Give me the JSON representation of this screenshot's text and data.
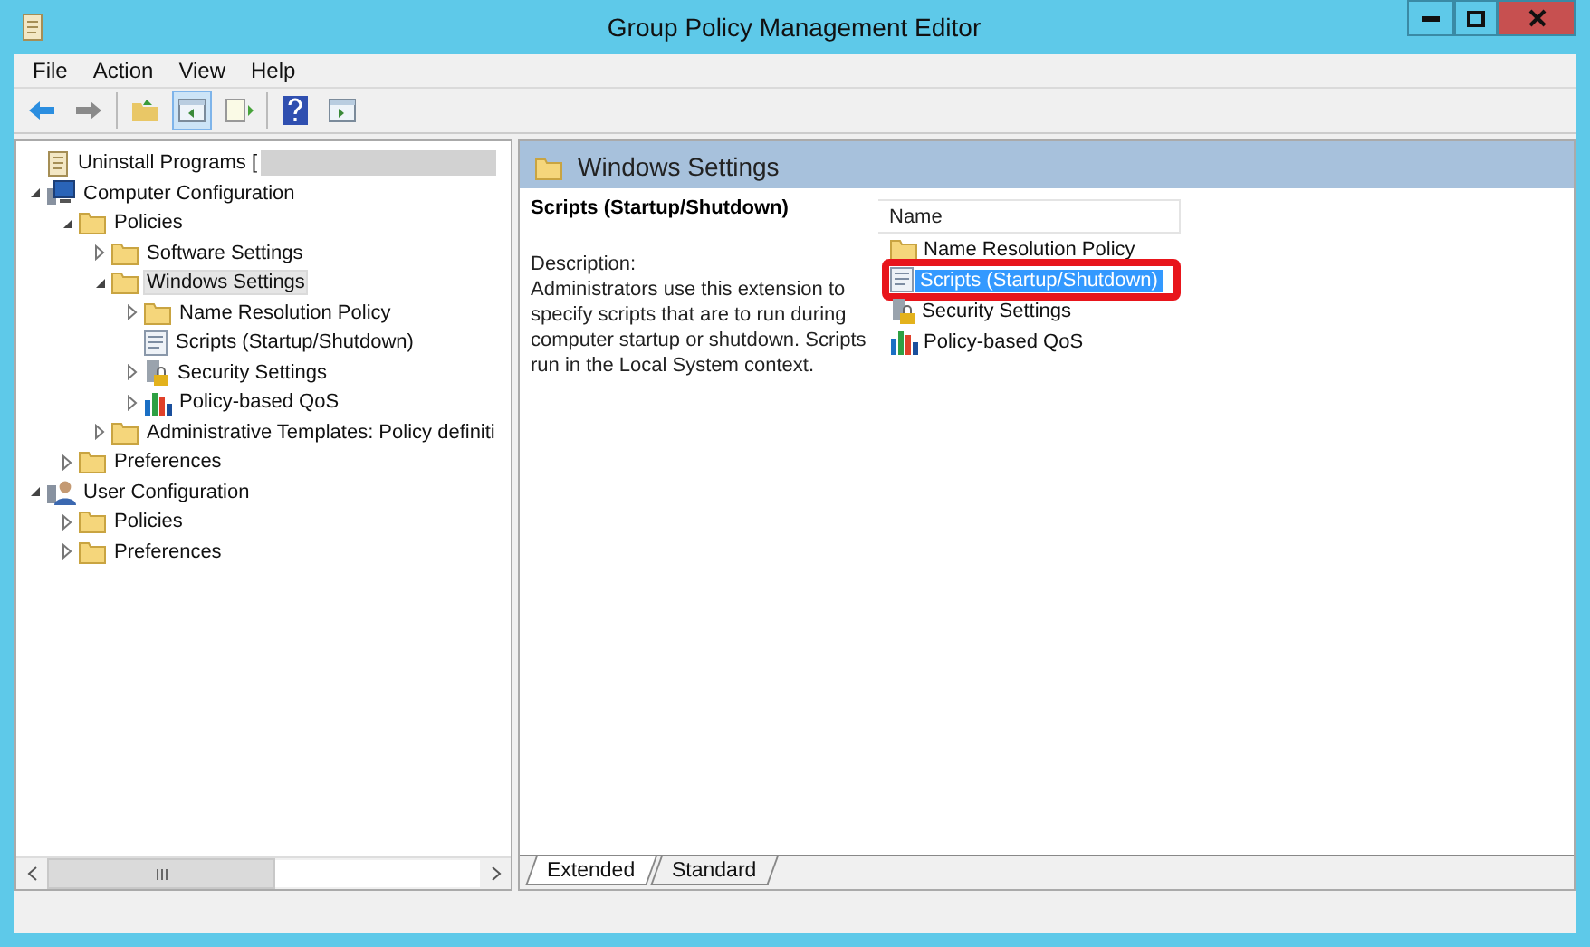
{
  "window": {
    "title": "Group Policy Management Editor"
  },
  "menu": [
    "File",
    "Action",
    "View",
    "Help"
  ],
  "tree": [
    {
      "label": "Uninstall Programs [",
      "kind": "document",
      "selected": false,
      "redacted": true
    },
    {
      "label": "Computer Configuration",
      "kind": "computer",
      "expanded": true,
      "selected": false,
      "children": [
        {
          "label": "Policies",
          "kind": "folder",
          "expanded": true,
          "selected": false,
          "children": [
            {
              "label": "Software Settings",
              "kind": "folder",
              "expanded": false,
              "selected": false
            },
            {
              "label": "Windows Settings",
              "kind": "folder",
              "expanded": true,
              "selected": true,
              "children": [
                {
                  "label": "Name Resolution Policy",
                  "kind": "folder",
                  "expanded": false,
                  "selected": false
                },
                {
                  "label": "Scripts (Startup/Shutdown)",
                  "kind": "script",
                  "selected": false
                },
                {
                  "label": "Security Settings",
                  "kind": "security",
                  "expanded": false,
                  "selected": false
                },
                {
                  "label": "Policy-based QoS",
                  "kind": "chart",
                  "expanded": false,
                  "selected": false
                }
              ]
            },
            {
              "label": "Administrative Templates: Policy definiti",
              "kind": "folder",
              "expanded": false,
              "selected": false
            }
          ]
        },
        {
          "label": "Preferences",
          "kind": "folder",
          "expanded": false,
          "selected": false
        }
      ]
    },
    {
      "label": "User Configuration",
      "kind": "user",
      "expanded": true,
      "selected": false,
      "children": [
        {
          "label": "Policies",
          "kind": "folder",
          "expanded": false,
          "selected": false
        },
        {
          "label": "Preferences",
          "kind": "folder",
          "expanded": false,
          "selected": false
        }
      ]
    }
  ],
  "details": {
    "header": "Windows Settings",
    "item_title": "Scripts (Startup/Shutdown)",
    "description_label": "Description:",
    "description": "Administrators use this extension to specify scripts that are to run during computer startup or shutdown. Scripts run in the Local System context.",
    "columns": [
      "Name"
    ],
    "items": [
      {
        "name": "Name Resolution Policy",
        "kind": "folder",
        "selected": false,
        "highlighted": false
      },
      {
        "name": "Scripts (Startup/Shutdown)",
        "kind": "script",
        "selected": true,
        "highlighted": true
      },
      {
        "name": "Security Settings",
        "kind": "security",
        "selected": false,
        "highlighted": false
      },
      {
        "name": "Policy-based QoS",
        "kind": "chart",
        "selected": false,
        "highlighted": false
      }
    ]
  },
  "tabs": [
    {
      "label": "Extended",
      "selected": true
    },
    {
      "label": "Standard",
      "selected": false
    }
  ]
}
